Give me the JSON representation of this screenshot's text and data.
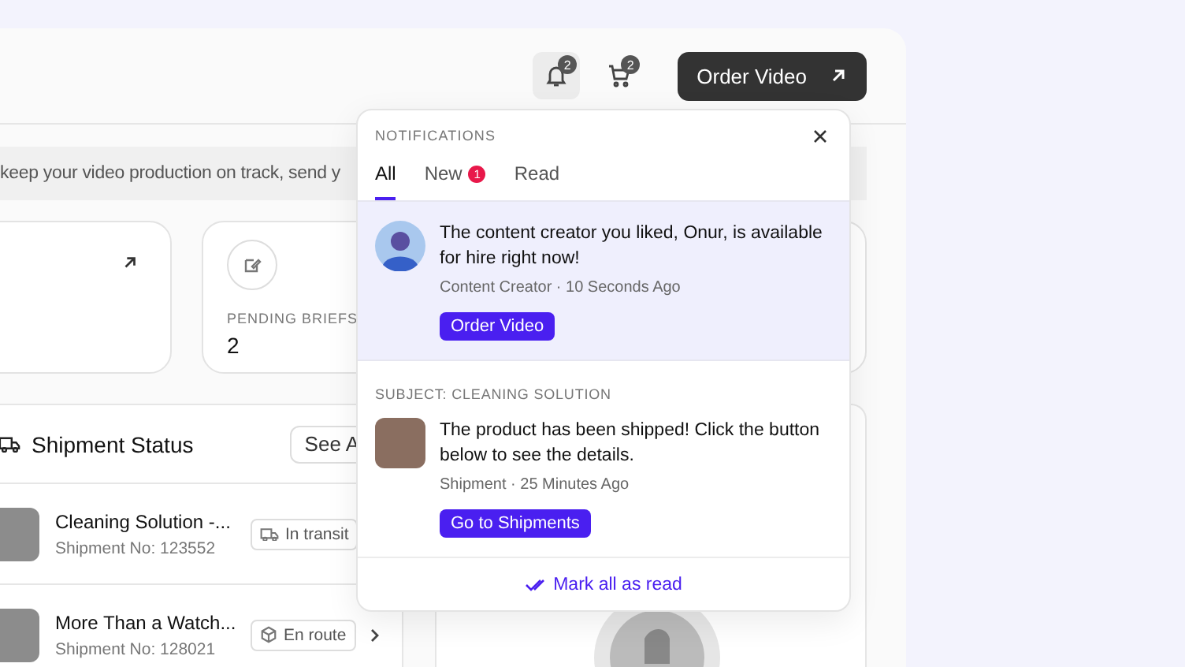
{
  "header": {
    "bell_badge": "2",
    "cart_badge": "2",
    "order_button": "Order Video"
  },
  "banner": {
    "text": "keep your video production on track, send y"
  },
  "stats": [
    {
      "label": "PENDING BRIEFS",
      "value": "2"
    }
  ],
  "shipments": {
    "title": "Shipment Status",
    "see_all": "See A",
    "rows": [
      {
        "name": "Cleaning Solution -...",
        "number": "Shipment No: 123552",
        "status": "In transit",
        "kind": "transit"
      },
      {
        "name": "More Than a Watch...",
        "number": "Shipment No: 128021",
        "status": "En route",
        "kind": "route"
      }
    ]
  },
  "notifications": {
    "title": "NOTIFICATIONS",
    "tabs": [
      {
        "label": "All",
        "selected": true
      },
      {
        "label": "New",
        "badge": "1",
        "selected": false
      },
      {
        "label": "Read",
        "selected": false
      }
    ],
    "items": [
      {
        "kind": "creator",
        "unread": true,
        "message": "The content creator you liked, Onur, is available for hire right now!",
        "meta": "Content Creator · 10 Seconds Ago",
        "action": "Order Video"
      },
      {
        "kind": "shipment",
        "unread": false,
        "subject": "SUBJECT: CLEANING SOLUTION",
        "message": "The product has been shipped! Click the button below to see the details.",
        "meta": "Shipment · 25 Minutes Ago",
        "action": "Go to Shipments"
      }
    ],
    "mark_all": "Mark all as read"
  }
}
